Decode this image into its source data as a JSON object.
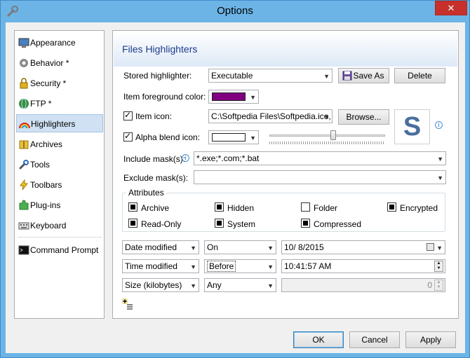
{
  "window": {
    "title": "Options",
    "close_label": "✕"
  },
  "sidebar": {
    "items": [
      {
        "label": "Appearance"
      },
      {
        "label": "Behavior *"
      },
      {
        "label": "Security *"
      },
      {
        "label": "FTP *"
      },
      {
        "label": "Highlighters",
        "selected": true
      },
      {
        "label": "Archives"
      },
      {
        "label": "Tools"
      },
      {
        "label": "Toolbars"
      },
      {
        "label": "Plug-ins"
      },
      {
        "label": "Keyboard"
      },
      {
        "label": "Command Prompt"
      }
    ]
  },
  "panel": {
    "title": "Files Highlighters",
    "stored_highlighter": {
      "label": "Stored highlighter:",
      "value": "Executable"
    },
    "save_as_label": "Save As",
    "delete_label": "Delete",
    "foreground": {
      "label": "Item foreground color:",
      "color": "#800080"
    },
    "item_icon": {
      "label": "Item icon:",
      "checked": true,
      "value": "C:\\Softpedia Files\\Softpedia.ico,"
    },
    "browse_label": "Browse...",
    "alpha_blend": {
      "label": "Alpha blend icon:",
      "checked": true,
      "color": "#ffffff",
      "level": 0.55
    },
    "preview_glyph": "S",
    "include_mask": {
      "label": "Include mask(s):",
      "value": "*.exe;*.com;*.bat"
    },
    "exclude_mask": {
      "label": "Exclude mask(s):",
      "value": ""
    },
    "attributes": {
      "legend": "Attributes",
      "items": [
        {
          "label": "Archive",
          "state": "indeterminate"
        },
        {
          "label": "Hidden",
          "state": "indeterminate"
        },
        {
          "label": "Folder",
          "state": "unchecked"
        },
        {
          "label": "Encrypted",
          "state": "indeterminate"
        },
        {
          "label": "Read-Only",
          "state": "indeterminate"
        },
        {
          "label": "System",
          "state": "indeterminate"
        },
        {
          "label": "Compressed",
          "state": "indeterminate"
        }
      ]
    },
    "filters": [
      {
        "field": "Date modified",
        "op": "On",
        "value": "10/  8/2015"
      },
      {
        "field": "Time modified",
        "op": "Before",
        "value": "10:41:57 AM"
      },
      {
        "field": "Size (kilobytes)",
        "op": "Any",
        "value": "0"
      }
    ]
  },
  "footer": {
    "ok": "OK",
    "cancel": "Cancel",
    "apply": "Apply"
  },
  "colors": {
    "accent": "#6cb4e6",
    "panel_title": "#1d3b8a",
    "selected": "#cfe1f3"
  }
}
